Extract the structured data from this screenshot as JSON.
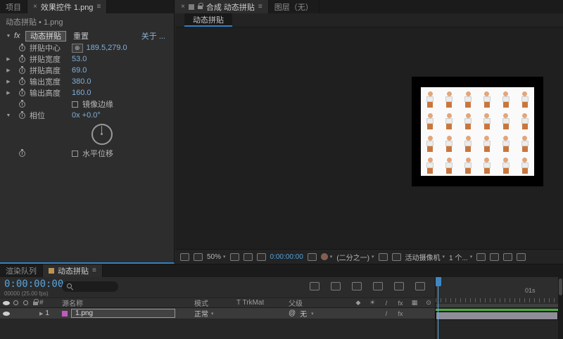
{
  "colors": {
    "accent_blue": "#2f82c8",
    "value_blue": "#7fb0dd",
    "timecode_blue": "#58a5dd",
    "render_green": "#49b23c",
    "comp_swatch": "#bd9352",
    "label_chip": "#c05ac0"
  },
  "icons": {
    "close": "×",
    "menu": "≡",
    "collapse_open": "▼",
    "collapse_closed": "▶",
    "dropdown": "▾",
    "point_picker": "⊕",
    "pickwhip": "@",
    "switch_headers": [
      "◆",
      "☀",
      "/",
      "fx",
      "▦",
      "⊙",
      "◐"
    ]
  },
  "left_panel": {
    "tabs": {
      "project": "项目",
      "effect_controls": "效果控件 1.png"
    },
    "source_line": "动态拼贴 • 1.png",
    "effect": {
      "fx_badge": "fx",
      "name": "动态拼贴",
      "reset": "重置",
      "about": "关于 ...",
      "properties": [
        {
          "label": "拼贴中心",
          "value": "189.5,279.0"
        },
        {
          "label": "拼贴宽度",
          "value": "53.0"
        },
        {
          "label": "拼贴高度",
          "value": "69.0"
        },
        {
          "label": "输出宽度",
          "value": "380.0"
        },
        {
          "label": "输出高度",
          "value": "160.0"
        },
        {
          "label": "镜像边缘",
          "checked": false
        },
        {
          "label": "相位",
          "value": "0x +0.0°"
        },
        {
          "label": "水平位移",
          "checked": false
        }
      ]
    }
  },
  "comp_panel": {
    "tab_active": "合成 动态拼贴",
    "tab_inactive": "图层（无）",
    "viewer_tab": "动态拼贴",
    "sprite": {
      "cols": 6,
      "rows": 4
    },
    "toolbar": {
      "zoom": "50%",
      "timecode": "0:00:00:00",
      "resolution": "(二分之一)",
      "camera": "活动摄像机",
      "views": "1 个..."
    }
  },
  "timeline": {
    "tab_render_queue": "渲染队列",
    "tab_comp": "动态拼贴",
    "timecode": "0:00:00:00",
    "frame_info": "00000 (25.00 fps)",
    "columns": {
      "number": "#",
      "source": "源名称",
      "mode": "模式",
      "trkmat": "T TrkMat",
      "parent": "父级"
    },
    "layer": {
      "number": "1",
      "name": "1.png",
      "mode": "正常",
      "parent": "无",
      "switch_quality": "/",
      "switch_fx": "fx"
    },
    "ruler_label": "01s"
  }
}
